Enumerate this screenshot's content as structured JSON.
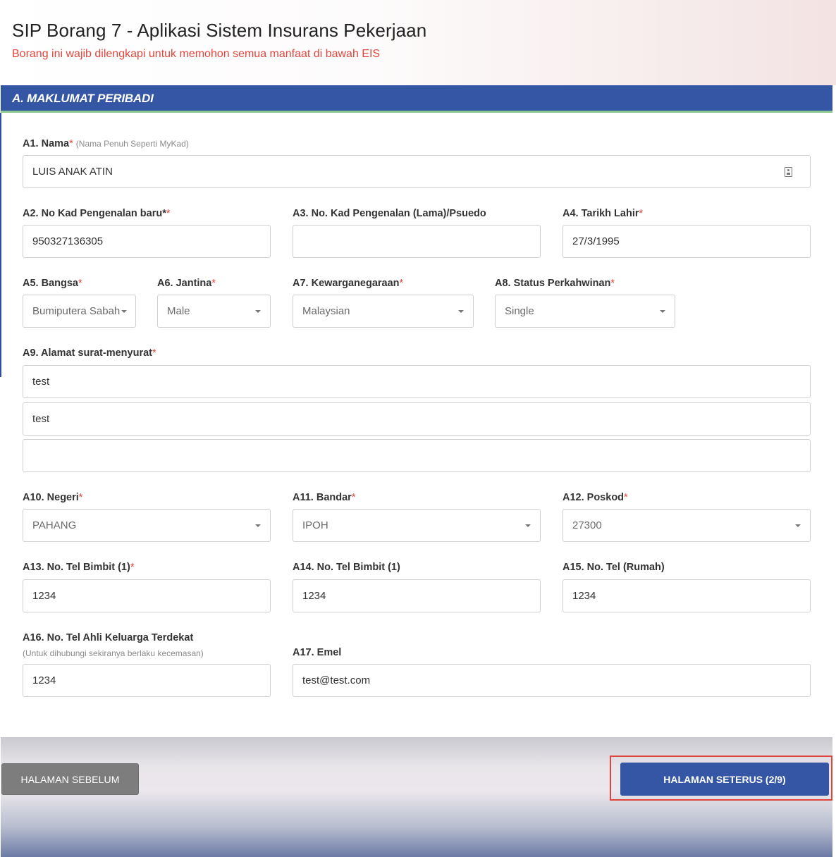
{
  "header": {
    "title": "SIP Borang 7 - Aplikasi Sistem Insurans Pekerjaan",
    "subtitle": "Borang ini wajib dilengkapi untuk memohon semua manfaat di bawah EIS"
  },
  "section": {
    "title": "A. MAKLUMAT PERIBADI"
  },
  "required_marker": "*",
  "form": {
    "a1": {
      "label": "A1. Nama",
      "hint": "(Nama Penuh Seperti MyKad)",
      "value": "LUIS ANAK ATIN"
    },
    "a2": {
      "label": "A2. No Kad Pengenalan baru*",
      "value": "950327136305"
    },
    "a3": {
      "label": "A3. No. Kad Pengenalan (Lama)/Psuedo",
      "value": ""
    },
    "a4": {
      "label": "A4. Tarikh Lahir",
      "value": "27/3/1995"
    },
    "a5": {
      "label": "A5. Bangsa",
      "value": "Bumiputera Sabah"
    },
    "a6": {
      "label": "A6. Jantina",
      "value": "Male"
    },
    "a7": {
      "label": "A7. Kewarganegaraan",
      "value": "Malaysian"
    },
    "a8": {
      "label": "A8. Status Perkahwinan",
      "value": "Single"
    },
    "a9": {
      "label": "A9. Alamat surat-menyurat",
      "line1": "test",
      "line2": "test",
      "line3": ""
    },
    "a10": {
      "label": "A10. Negeri",
      "value": "PAHANG"
    },
    "a11": {
      "label": "A11. Bandar",
      "value": "IPOH"
    },
    "a12": {
      "label": "A12. Poskod",
      "value": "27300"
    },
    "a13": {
      "label": "A13. No. Tel Bimbit (1)",
      "value": "1234"
    },
    "a14": {
      "label": "A14. No. Tel Bimbit (1)",
      "value": "1234"
    },
    "a15": {
      "label": "A15. No. Tel (Rumah)",
      "value": "1234"
    },
    "a16": {
      "label": "A16. No. Tel Ahli Keluarga Terdekat",
      "hint": "(Untuk dihubungi sekiranya berlaku kecemasan)",
      "value": "1234"
    },
    "a17": {
      "label": "A17. Emel",
      "value": "test@test.com"
    }
  },
  "footer": {
    "prev_label": "HALAMAN SEBELUM",
    "next_label": "HALAMAN SETERUS (2/9)"
  },
  "colors": {
    "primary": "#3456a5",
    "required": "#e4463d",
    "section_underline": "#8bc88f",
    "prev_button": "#7d7d7d",
    "highlight": "#e0453c"
  },
  "icons": {
    "name_field_icon": "id-card-icon",
    "dropdown": "caret-down-icon"
  }
}
